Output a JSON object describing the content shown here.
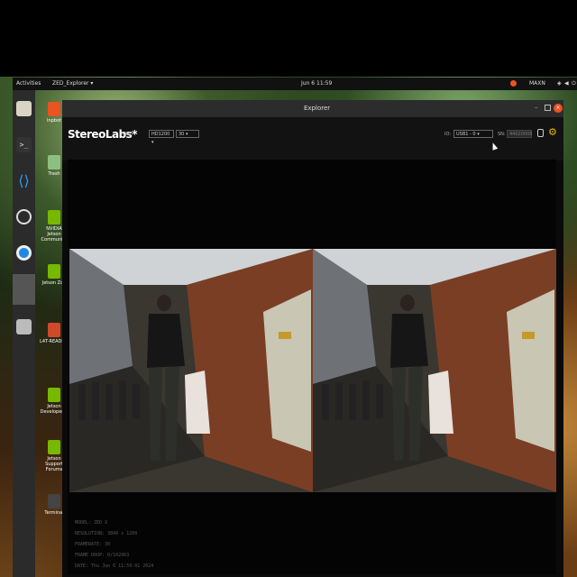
{
  "topbar": {
    "activities": "Activities",
    "app_menu": "ZED_Explorer ▾",
    "clock": "Jun 6  11:59",
    "power_mode": "MAXN"
  },
  "desktop_icons": [
    {
      "label": "Inpbot"
    },
    {
      "label": "Trash"
    },
    {
      "label": "NVIDIA Jetson Community"
    },
    {
      "label": "Jetson Zoo"
    },
    {
      "label": "L4T-README"
    },
    {
      "label": "Jetson Developer Z"
    },
    {
      "label": "Jetson Support Forums"
    },
    {
      "label": "Terminal"
    }
  ],
  "window": {
    "title": "Explorer",
    "brand": "StereoLabs*",
    "live_label": "LIVE",
    "resolution_select": "HD1200",
    "fps_select": "30",
    "io_label": "IO:",
    "io_select": "USB1 - 0",
    "sn_label": "SN:",
    "sn_value": "44020006"
  },
  "camera_info": {
    "model": "MODEL: ZED X",
    "resolution": "RESOLUTION: 3840 x 1200",
    "framerate": "FRAMERATE: 30",
    "frame_drop": "FRAME DROP: 0/102963",
    "date": "DATE: Thu Jun 6 11:59:01 2024"
  },
  "colors": {
    "window_bg": "#0a0a0a",
    "titlebar": "#2c2c2c",
    "close_button": "#e95420",
    "settings_accent": "#e8b700"
  }
}
